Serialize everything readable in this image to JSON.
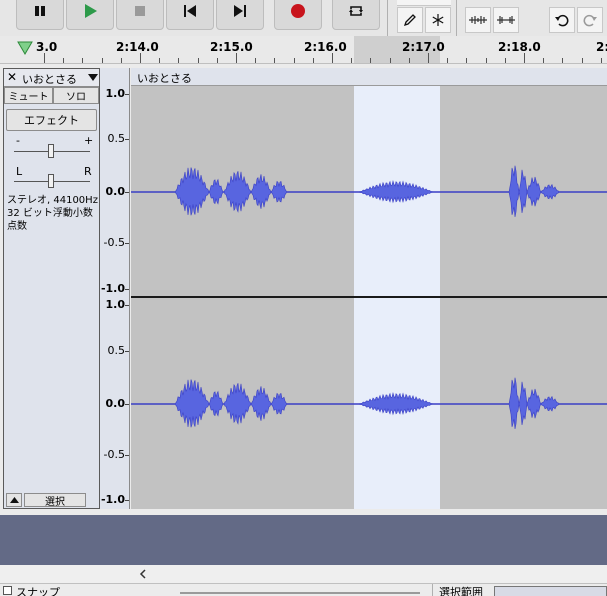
{
  "toolbar": {
    "buttons": [
      "pause-icon",
      "play-icon",
      "stop-icon",
      "skip-start-icon",
      "skip-end-icon",
      "record-icon",
      "loop-icon"
    ],
    "tools": [
      "pencil-icon",
      "multi-tool-icon",
      "undo-icon",
      "redo-icon"
    ]
  },
  "timeline": {
    "labels": [
      "3.0",
      "2:14.0",
      "2:15.0",
      "2:16.0",
      "2:17.0",
      "2:18.0",
      "2:"
    ]
  },
  "track": {
    "name": "いおとさる",
    "mute_label": "ミュート",
    "solo_label": "ソロ",
    "effect_label": "エフェクト",
    "gain_minus": "-",
    "gain_plus": "+",
    "pan_left": "L",
    "pan_right": "R",
    "format_line1": "ステレオ, 44100Hz",
    "format_line2": "32 ビット浮動小数点数",
    "select_label": "選択",
    "clip_name": "いおとさる",
    "ruler_top": [
      "1.0",
      "0.5",
      "0.0",
      "-0.5",
      "-1.0"
    ],
    "ruler_bottom": [
      "1.0",
      "0.5",
      "0.0",
      "-0.5",
      "-1.0"
    ]
  },
  "status": {
    "snap_label": "スナップ",
    "selection_label": "選択範囲"
  },
  "colors": {
    "waveform": "#5865e0",
    "waveform_line": "#3a3fc4",
    "selection": "#e8eefa",
    "background_track": "#c2c2c2",
    "empty_area": "#636a86"
  }
}
